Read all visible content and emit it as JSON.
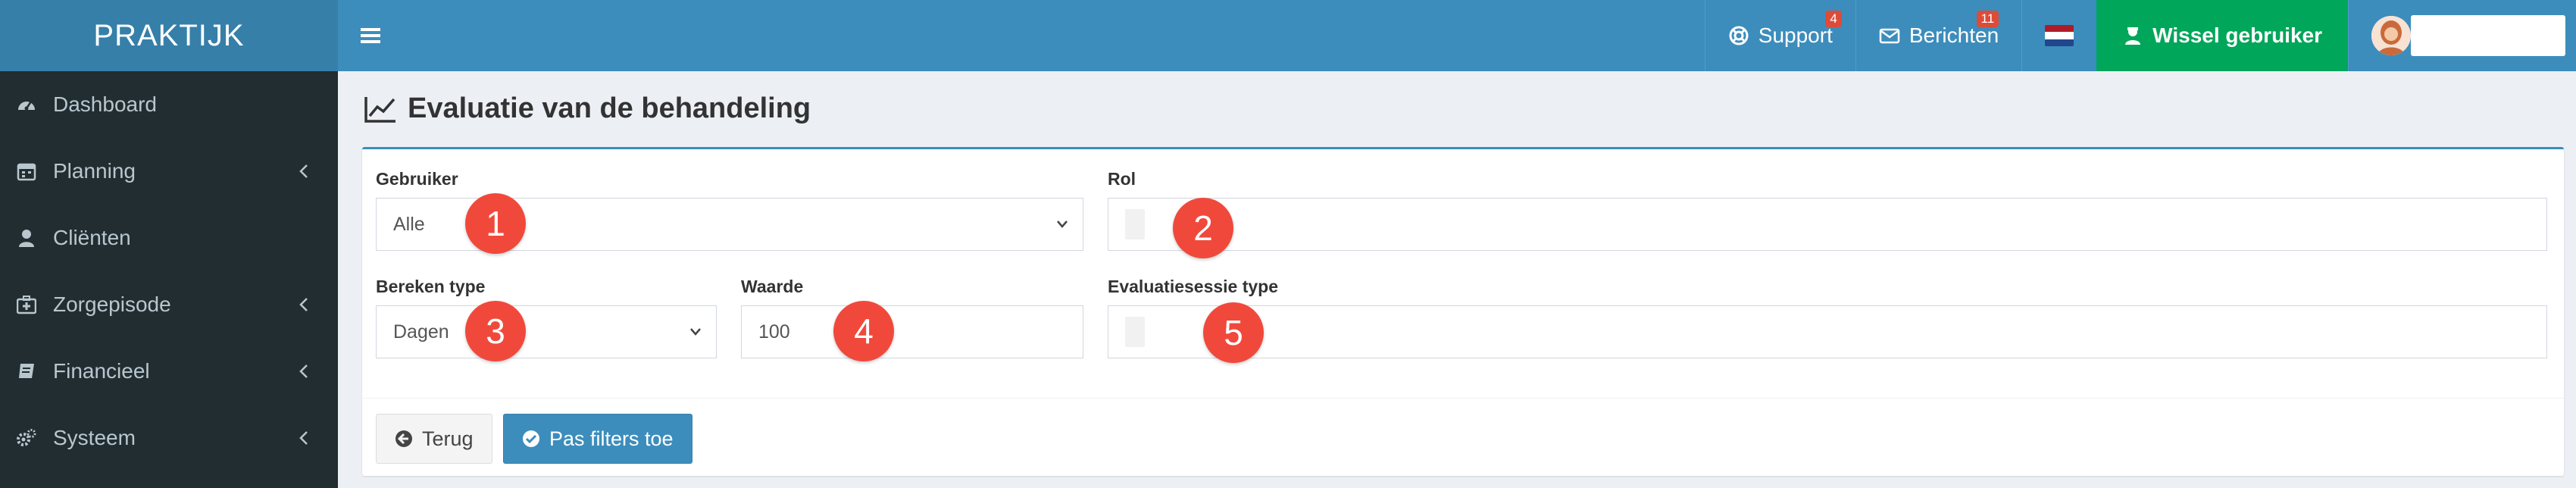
{
  "brand": {
    "logo_text": "PRAKTIJK"
  },
  "topbar": {
    "menu_toggle_icon": "bars-icon",
    "support": {
      "label": "Support",
      "badge": "4",
      "icon": "life-ring-icon"
    },
    "messages": {
      "label": "Berichten",
      "badge": "11",
      "icon": "envelope-icon"
    },
    "language_flag": {
      "icon": "flag-nl-icon",
      "colors": [
        "#ae1c28",
        "#ffffff",
        "#21468b"
      ]
    },
    "switch_user": {
      "label": "Wissel gebruiker",
      "icon": "user-secret-icon",
      "color": "#00a65a"
    },
    "user": {
      "avatar_icon": "user-avatar"
    }
  },
  "sidebar": {
    "items": [
      {
        "label": "Dashboard",
        "icon": "tachometer-icon",
        "has_submenu": false
      },
      {
        "label": "Planning",
        "icon": "calendar-icon",
        "has_submenu": true
      },
      {
        "label": "Cliënten",
        "icon": "user-icon",
        "has_submenu": false
      },
      {
        "label": "Zorgepisode",
        "icon": "medkit-icon",
        "has_submenu": true
      },
      {
        "label": "Financieel",
        "icon": "book-icon",
        "has_submenu": true
      },
      {
        "label": "Systeem",
        "icon": "cogs-icon",
        "has_submenu": true
      }
    ]
  },
  "page": {
    "title": "Evaluatie van de behandeling",
    "title_icon": "line-chart-icon"
  },
  "filters": {
    "gebruiker": {
      "label": "Gebruiker",
      "value": "Alle"
    },
    "rol": {
      "label": "Rol",
      "value": ""
    },
    "bereken_type": {
      "label": "Bereken type",
      "value": "Dagen"
    },
    "waarde": {
      "label": "Waarde",
      "value": "100"
    },
    "evaluatiesessie_type": {
      "label": "Evaluatiesessie type",
      "value": ""
    }
  },
  "markers": [
    "1",
    "2",
    "3",
    "4",
    "5"
  ],
  "actions": {
    "back": {
      "label": "Terug",
      "icon": "arrow-circle-left-icon"
    },
    "apply": {
      "label": "Pas filters toe",
      "icon": "check-circle-icon"
    }
  },
  "colors": {
    "primary": "#3c8dbc",
    "sidebar": "#222d32",
    "marker": "#f0493c",
    "badge": "#dd4b39"
  }
}
